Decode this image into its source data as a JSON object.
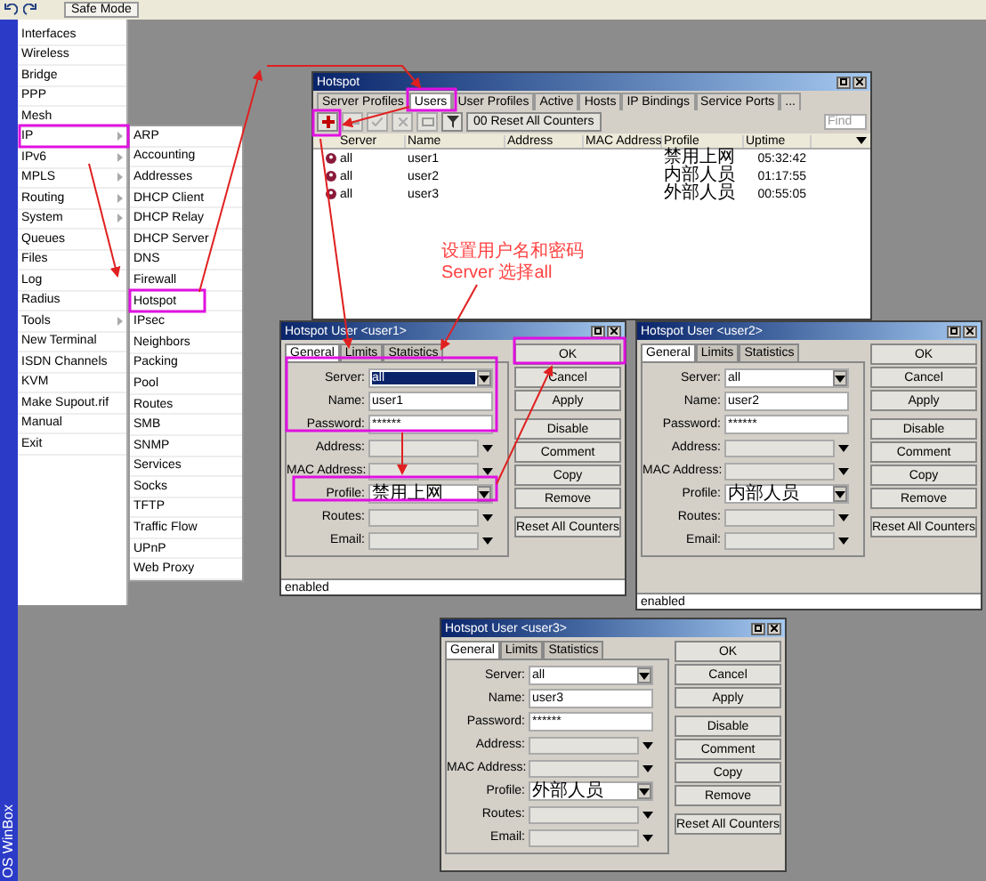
{
  "toolbar": {
    "safe_mode": "Safe Mode"
  },
  "side_label": "OS WinBox",
  "menu": [
    {
      "label": "Interfaces",
      "has_submenu": false
    },
    {
      "label": "Wireless",
      "has_submenu": false
    },
    {
      "label": "Bridge",
      "has_submenu": false
    },
    {
      "label": "PPP",
      "has_submenu": false
    },
    {
      "label": "Mesh",
      "has_submenu": false
    },
    {
      "label": "IP",
      "has_submenu": true
    },
    {
      "label": "IPv6",
      "has_submenu": true
    },
    {
      "label": "MPLS",
      "has_submenu": true
    },
    {
      "label": "Routing",
      "has_submenu": true
    },
    {
      "label": "System",
      "has_submenu": true
    },
    {
      "label": "Queues",
      "has_submenu": false
    },
    {
      "label": "Files",
      "has_submenu": false
    },
    {
      "label": "Log",
      "has_submenu": false
    },
    {
      "label": "Radius",
      "has_submenu": false
    },
    {
      "label": "Tools",
      "has_submenu": true
    },
    {
      "label": "New Terminal",
      "has_submenu": false
    },
    {
      "label": "ISDN Channels",
      "has_submenu": false
    },
    {
      "label": "KVM",
      "has_submenu": false
    },
    {
      "label": "Make Supout.rif",
      "has_submenu": false
    },
    {
      "label": "Manual",
      "has_submenu": false
    },
    {
      "label": "Exit",
      "has_submenu": false
    }
  ],
  "submenu": [
    "ARP",
    "Accounting",
    "Addresses",
    "DHCP Client",
    "DHCP Relay",
    "DHCP Server",
    "DNS",
    "Firewall",
    "Hotspot",
    "IPsec",
    "Neighbors",
    "Packing",
    "Pool",
    "Routes",
    "SMB",
    "SNMP",
    "Services",
    "Socks",
    "TFTP",
    "Traffic Flow",
    "UPnP",
    "Web Proxy"
  ],
  "hotspot_window": {
    "title": "Hotspot",
    "tabs": [
      {
        "label": "Server Profiles",
        "selected": false
      },
      {
        "label": "Users",
        "selected": true
      },
      {
        "label": "User Profiles",
        "selected": false
      },
      {
        "label": "Active",
        "selected": false
      },
      {
        "label": "Hosts",
        "selected": false
      },
      {
        "label": "IP Bindings",
        "selected": false
      },
      {
        "label": "Service Ports",
        "selected": false
      },
      {
        "label": "...",
        "selected": false
      }
    ],
    "reset_button": "00 Reset All Counters",
    "find_placeholder": "Find",
    "columns": [
      "Server",
      "Name",
      "Address",
      "MAC Address",
      "Profile",
      "Uptime"
    ],
    "rows": [
      [
        "all",
        "user1",
        "",
        "",
        "禁用上网",
        "05:32:42"
      ],
      [
        "all",
        "user2",
        "",
        "",
        "内部人员",
        "01:17:55"
      ],
      [
        "all",
        "user3",
        "",
        "",
        "外部人员",
        "00:55:05"
      ]
    ]
  },
  "annotation": [
    "设置用户名和密码",
    "Server 选择all"
  ],
  "dialogs": [
    {
      "title": "Hotspot User <user1>",
      "tabs": [
        {
          "label": "General",
          "selected": true
        },
        {
          "label": "Limits",
          "selected": false
        },
        {
          "label": "Statistics",
          "selected": false
        }
      ],
      "fields": [
        {
          "label": "Server:",
          "kind": "select",
          "value": "all",
          "text_selected": true
        },
        {
          "label": "Name:",
          "kind": "text",
          "value": "user1",
          "text_selected": false
        },
        {
          "label": "Password:",
          "kind": "text",
          "value": "******",
          "text_selected": false
        },
        {
          "label": "Address:",
          "kind": "combo",
          "text_selected": false
        },
        {
          "label": "MAC Address:",
          "kind": "combo",
          "text_selected": false
        },
        {
          "label": "Profile:",
          "kind": "select",
          "value": "禁用上网",
          "text_selected": false
        },
        {
          "label": "Routes:",
          "kind": "combo",
          "text_selected": false
        },
        {
          "label": "Email:",
          "kind": "combo",
          "text_selected": false
        }
      ],
      "button_groups": [
        [
          "OK",
          "Cancel",
          "Apply"
        ],
        [
          "Disable",
          "Comment",
          "Copy",
          "Remove"
        ],
        [
          "Reset All Counters"
        ]
      ],
      "status": "enabled"
    },
    {
      "title": "Hotspot User <user2>",
      "tabs": [
        {
          "label": "General",
          "selected": true
        },
        {
          "label": "Limits",
          "selected": false
        },
        {
          "label": "Statistics",
          "selected": false
        }
      ],
      "fields": [
        {
          "label": "Server:",
          "kind": "select",
          "value": "all",
          "text_selected": false
        },
        {
          "label": "Name:",
          "kind": "text",
          "value": "user2",
          "text_selected": false
        },
        {
          "label": "Password:",
          "kind": "text",
          "value": "******",
          "text_selected": false
        },
        {
          "label": "Address:",
          "kind": "combo",
          "text_selected": false
        },
        {
          "label": "MAC Address:",
          "kind": "combo",
          "text_selected": false
        },
        {
          "label": "Profile:",
          "kind": "select",
          "value": "内部人员",
          "text_selected": false
        },
        {
          "label": "Routes:",
          "kind": "combo",
          "text_selected": false
        },
        {
          "label": "Email:",
          "kind": "combo",
          "text_selected": false
        }
      ],
      "button_groups": [
        [
          "OK",
          "Cancel",
          "Apply"
        ],
        [
          "Disable",
          "Comment",
          "Copy",
          "Remove"
        ],
        [
          "Reset All Counters"
        ]
      ],
      "status": "enabled"
    },
    {
      "title": "Hotspot User <user3>",
      "tabs": [
        {
          "label": "General",
          "selected": true
        },
        {
          "label": "Limits",
          "selected": false
        },
        {
          "label": "Statistics",
          "selected": false
        }
      ],
      "fields": [
        {
          "label": "Server:",
          "kind": "select",
          "value": "all",
          "text_selected": false
        },
        {
          "label": "Name:",
          "kind": "text",
          "value": "user3",
          "text_selected": false
        },
        {
          "label": "Password:",
          "kind": "text",
          "value": "******",
          "text_selected": false
        },
        {
          "label": "Address:",
          "kind": "combo",
          "text_selected": false
        },
        {
          "label": "MAC Address:",
          "kind": "combo",
          "text_selected": false
        },
        {
          "label": "Profile:",
          "kind": "select",
          "value": "外部人员",
          "text_selected": false
        },
        {
          "label": "Routes:",
          "kind": "combo",
          "text_selected": false
        },
        {
          "label": "Email:",
          "kind": "combo",
          "text_selected": false
        }
      ],
      "button_groups": [
        [
          "OK",
          "Cancel",
          "Apply"
        ],
        [
          "Disable",
          "Comment",
          "Copy",
          "Remove"
        ],
        [
          "Reset All Counters"
        ]
      ]
    }
  ]
}
